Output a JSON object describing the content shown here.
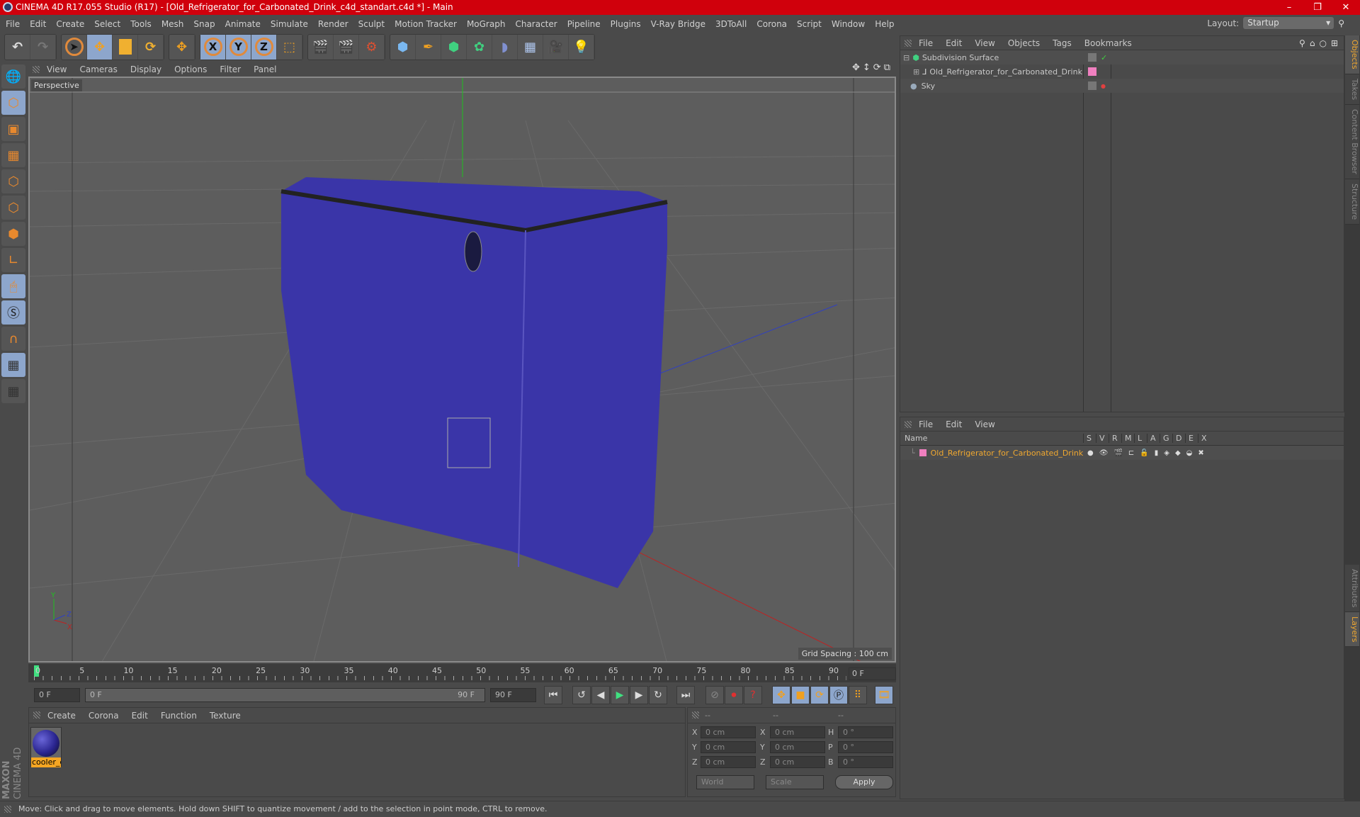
{
  "window": {
    "title": "CINEMA 4D R17.055 Studio (R17) - [Old_Refrigerator_for_Carbonated_Drink_c4d_standart.c4d *] - Main",
    "controls": [
      "–",
      "❐",
      "✕"
    ]
  },
  "menubar": {
    "items": [
      "File",
      "Edit",
      "Create",
      "Select",
      "Tools",
      "Mesh",
      "Snap",
      "Animate",
      "Simulate",
      "Render",
      "Sculpt",
      "Motion Tracker",
      "MoGraph",
      "Character",
      "Pipeline",
      "Plugins",
      "V-Ray Bridge",
      "3DToAll",
      "Corona",
      "Script",
      "Window",
      "Help"
    ],
    "layout_label": "Layout:",
    "layout_value": "Startup"
  },
  "toolbar": {
    "groups": [
      [
        "undo-icon",
        "redo-icon"
      ],
      [
        "select-icon",
        "move-icon",
        "scale-icon",
        "rotate-icon"
      ],
      [
        "live-selection-icon"
      ],
      [
        "x-axis-icon",
        "y-axis-icon",
        "z-axis-icon",
        "world-coord-icon"
      ],
      [
        "render-view-icon",
        "render-picture-viewer-icon",
        "render-settings-icon"
      ],
      [
        "cube-icon",
        "pen-icon",
        "subdivision-icon",
        "cloner-icon",
        "deformer-icon",
        "floor-icon",
        "camera-icon",
        "light-icon"
      ]
    ],
    "axis_labels": [
      "X",
      "Y",
      "Z"
    ]
  },
  "lefttools": [
    "make-editable-icon",
    "model-mode-icon",
    "texture-mode-icon",
    "workplane-icon",
    "points-mode-icon",
    "edges-mode-icon",
    "polygons-mode-icon",
    "axis-mode-icon",
    "tweak-mode-icon",
    "solo-icon",
    "snap-icon",
    "lock-workplane-icon",
    "workplane-align-icon"
  ],
  "viewport": {
    "menu": [
      "View",
      "Cameras",
      "Display",
      "Options",
      "Filter",
      "Panel"
    ],
    "camera_label": "Perspective",
    "grid_spacing": "Grid Spacing : 100 cm",
    "axis": {
      "x": "X",
      "y": "Y",
      "z": "Z"
    },
    "object_color": "#3a35a8"
  },
  "timeline": {
    "ticks": [
      "0",
      "5",
      "10",
      "15",
      "20",
      "25",
      "30",
      "35",
      "40",
      "45",
      "50",
      "55",
      "60",
      "65",
      "70",
      "75",
      "80",
      "85",
      "90"
    ],
    "current_frame": "0 F",
    "start_field": "0 F",
    "range_start": "0 F",
    "range_end": "90 F",
    "end_field": "90 F"
  },
  "material_panel": {
    "menu": [
      "Create",
      "Corona",
      "Edit",
      "Function",
      "Texture"
    ],
    "materials": [
      {
        "name": "cooler_c"
      }
    ]
  },
  "coord_panel": {
    "headers": [
      "--",
      "--",
      "--"
    ],
    "rows": [
      {
        "l1": "X",
        "v1": "0 cm",
        "l2": "X",
        "v2": "0 cm",
        "l3": "H",
        "v3": "0 °"
      },
      {
        "l1": "Y",
        "v1": "0 cm",
        "l2": "Y",
        "v2": "0 cm",
        "l3": "P",
        "v3": "0 °"
      },
      {
        "l1": "Z",
        "v1": "0 cm",
        "l2": "Z",
        "v2": "0 cm",
        "l3": "B",
        "v3": "0 °"
      }
    ],
    "mode": "World",
    "type": "Scale",
    "apply": "Apply"
  },
  "status": "Move: Click and drag to move elements. Hold down SHIFT to quantize movement / add to the selection in point mode, CTRL to remove.",
  "objects_panel": {
    "menu": [
      "File",
      "Edit",
      "View",
      "Objects",
      "Tags",
      "Bookmarks"
    ],
    "objects": [
      {
        "name": "Subdivision Surface",
        "icon": "subdivision-icon",
        "color": "#9aa"
      },
      {
        "name": "Old_Refrigerator_for_Carbonated_Drink",
        "icon": "null-icon",
        "color": "#f080c0"
      },
      {
        "name": "Sky",
        "icon": "sky-icon",
        "color": "#9aa"
      }
    ]
  },
  "layers_panel": {
    "menu": [
      "File",
      "Edit",
      "View"
    ],
    "columns": [
      "Name",
      "S",
      "V",
      "R",
      "M",
      "L",
      "A",
      "G",
      "D",
      "E",
      "X"
    ],
    "layers": [
      {
        "name": "Old_Refrigerator_for_Carbonated_Drink",
        "color": "#f080c0"
      }
    ]
  },
  "right_tabs": {
    "top": [
      "Objects",
      "Takes",
      "Content Browser",
      "Structure"
    ],
    "bottom": [
      "Attributes",
      "Layers"
    ]
  },
  "branding": {
    "brand": "MAXON",
    "product": "CINEMA 4D"
  }
}
